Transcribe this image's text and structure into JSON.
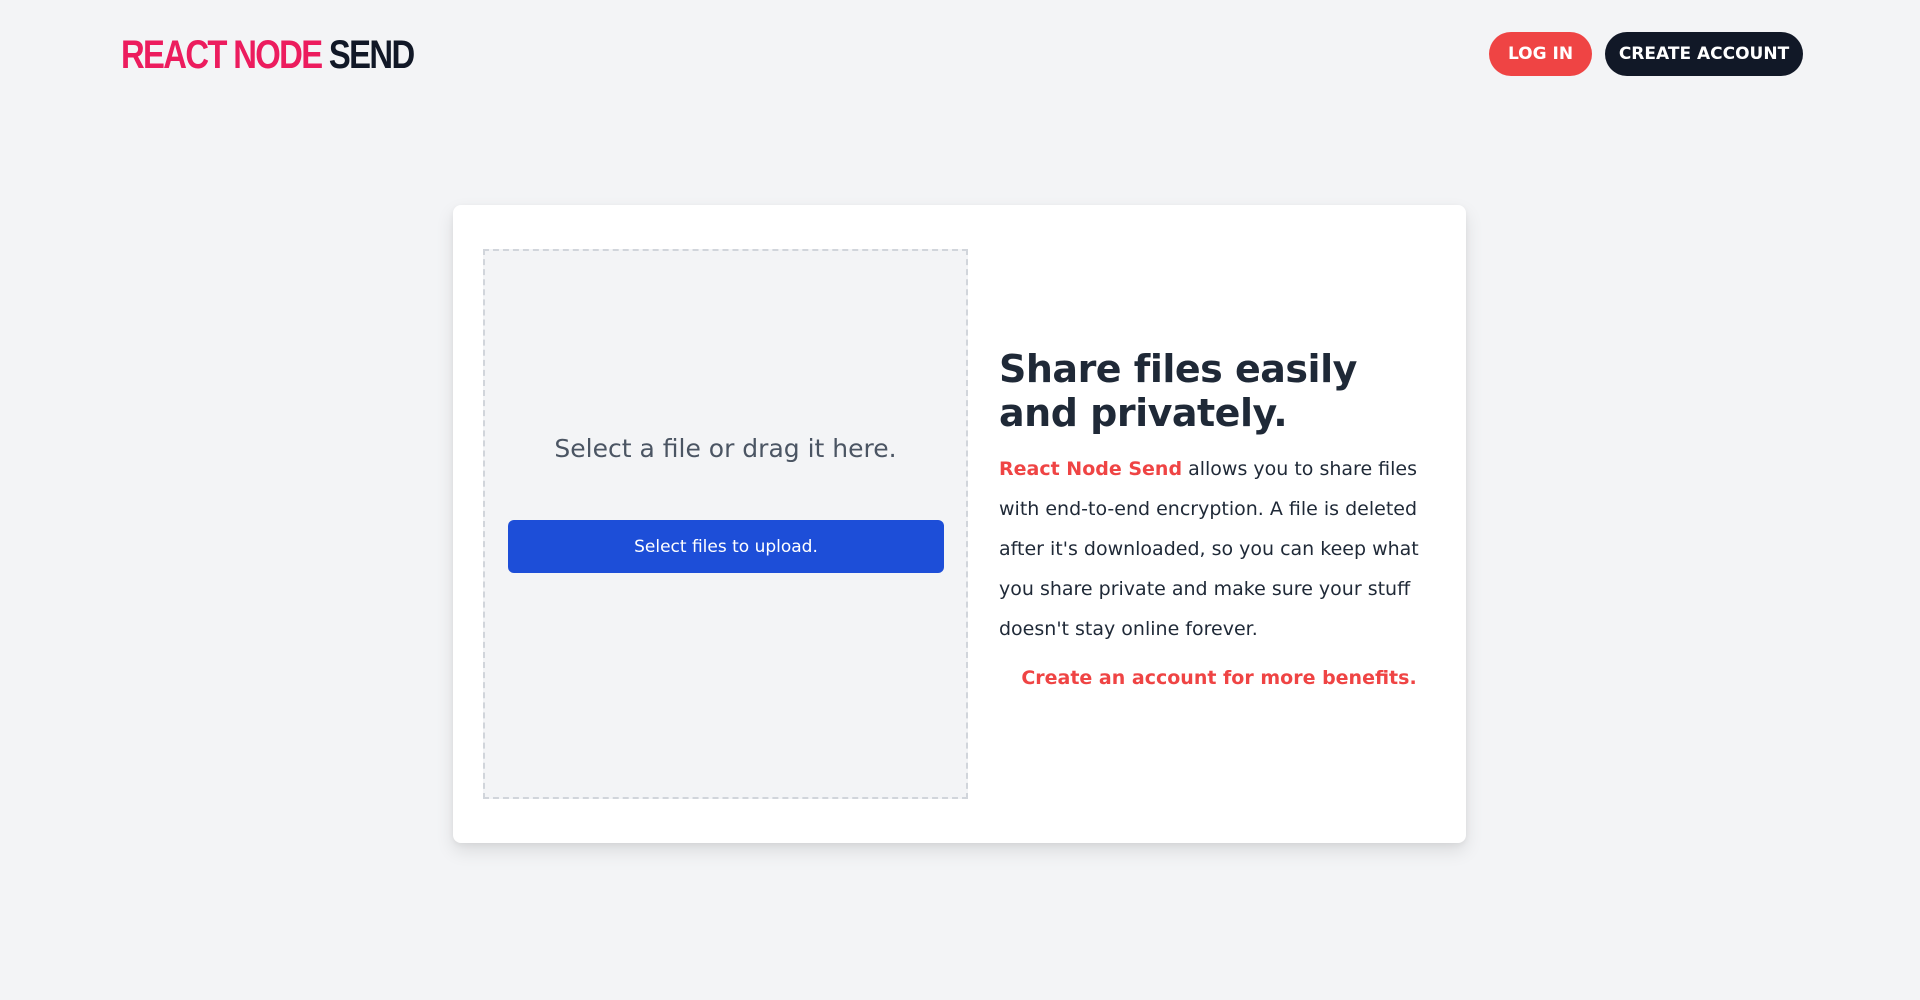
{
  "header": {
    "logo_part1": "REACT NODE",
    "logo_part2": "SEND",
    "login_label": "LOG IN",
    "create_account_label": "CREATE ACCOUNT"
  },
  "upload": {
    "prompt": "Select a file or drag it here.",
    "button_label": "Select files to upload."
  },
  "info": {
    "title": "Share files easily and privately.",
    "brand": "React Node Send",
    "body": " allows you to share files with end-to-end encryption. A file is deleted after it's downloaded, so you can keep what you share private and make sure your stuff doesn't stay online forever.",
    "cta": "Create an account for more benefits."
  },
  "colors": {
    "background": "#f3f4f6",
    "brand_pink": "#ec1c5e",
    "accent_red": "#ef4444",
    "dark": "#111827",
    "primary_blue": "#1d4ed8"
  }
}
